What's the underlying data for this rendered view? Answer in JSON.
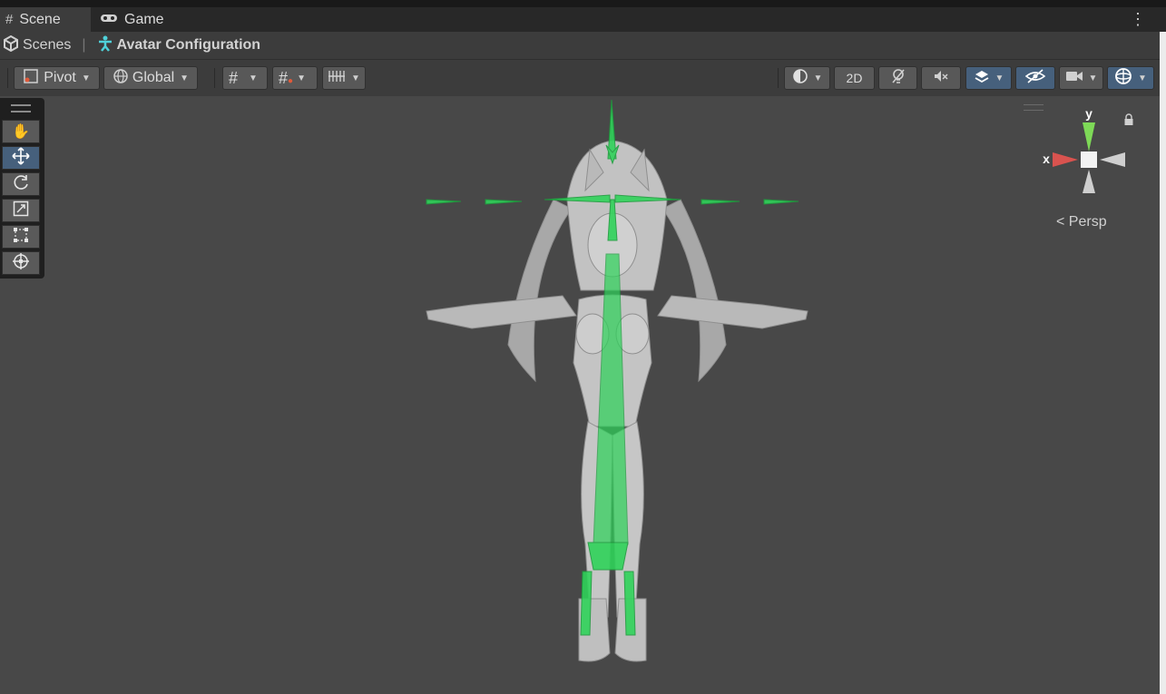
{
  "tabs": [
    {
      "label": "Scene",
      "icon": "scene-hash-icon"
    },
    {
      "label": "Game",
      "icon": "gamepad-icon"
    }
  ],
  "breadcrumb": {
    "scenes_label": "Scenes",
    "current_label": "Avatar Configuration"
  },
  "toolbar": {
    "pivot_label": "Pivot",
    "global_label": "Global",
    "mode_2d_label": "2D"
  },
  "tools": [
    "hand-tool",
    "move-tool",
    "rotate-tool",
    "scale-tool",
    "rect-tool",
    "transform-tool"
  ],
  "gizmo": {
    "y_label": "y",
    "x_label": "x",
    "projection_label": "Persp"
  },
  "colors": {
    "accent_blue": "#46607c",
    "bone_green": "#2fd35a",
    "axis_y": "#7ed957",
    "axis_x": "#d9534f"
  }
}
